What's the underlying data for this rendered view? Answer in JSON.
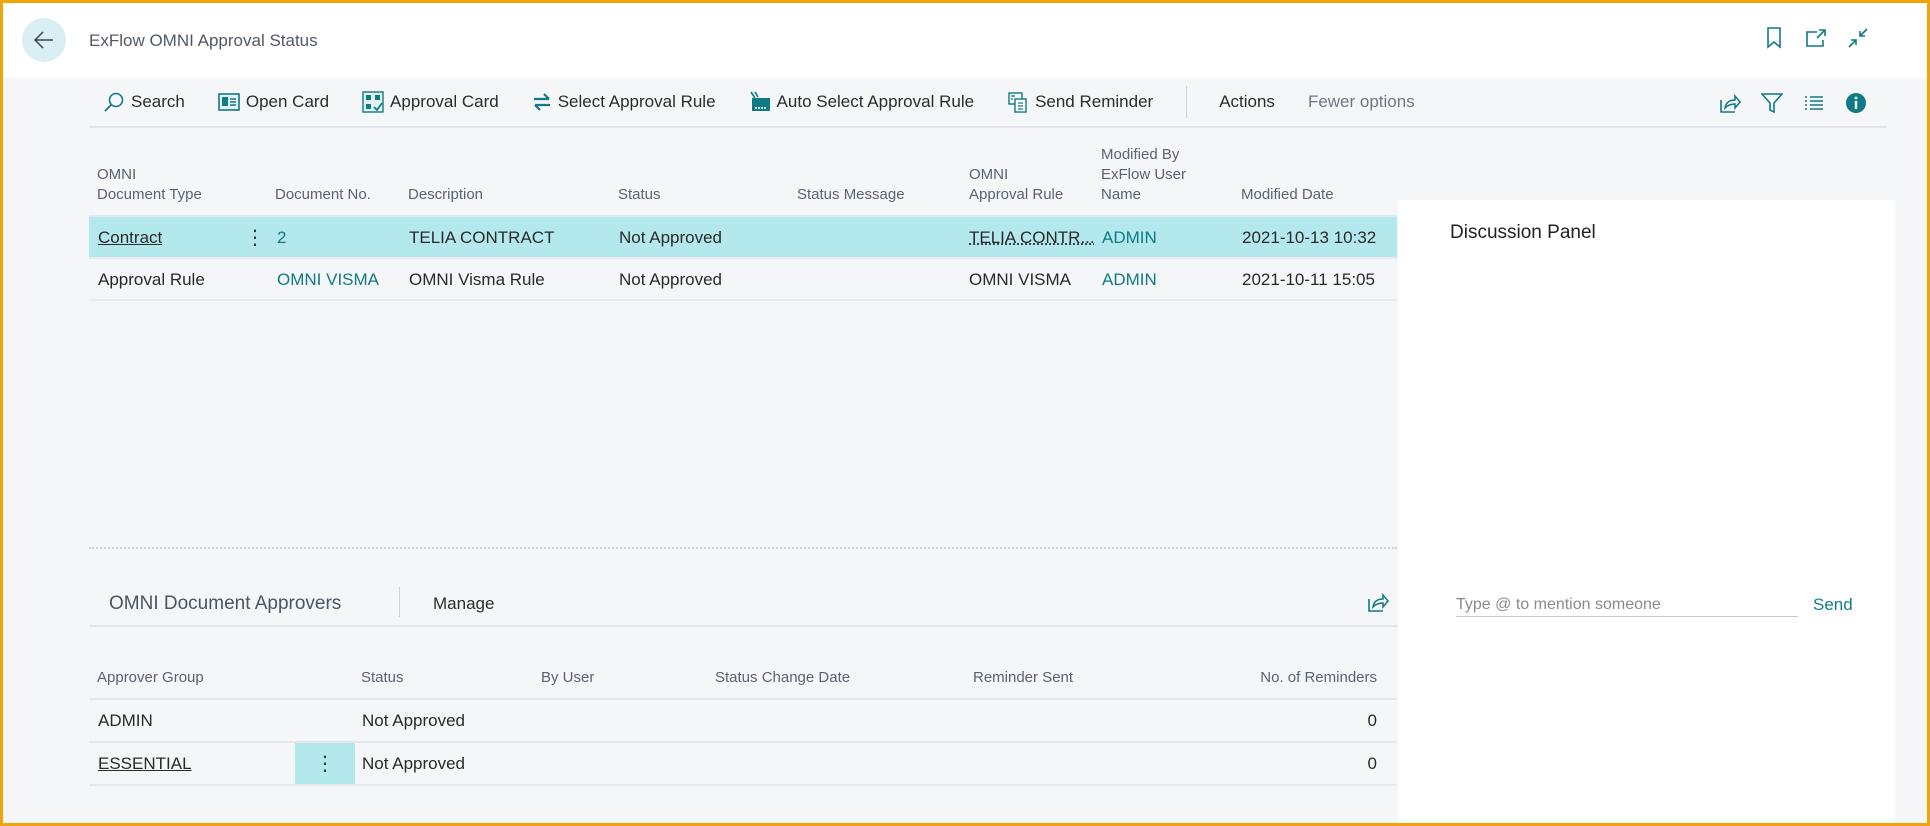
{
  "header": {
    "title": "ExFlow OMNI Approval Status",
    "icons": [
      "back-arrow-icon",
      "bookmark-icon",
      "open-new-window-icon",
      "collapse-icon"
    ]
  },
  "toolbar": {
    "items": [
      {
        "label": "Search",
        "icon": "search-icon"
      },
      {
        "label": "Open Card",
        "icon": "card-icon"
      },
      {
        "label": "Approval Card",
        "icon": "approval-card-icon"
      },
      {
        "label": "Select Approval Rule",
        "icon": "swap-arrows-icon"
      },
      {
        "label": "Auto Select Approval Rule",
        "icon": "auto-select-icon"
      },
      {
        "label": "Send Reminder",
        "icon": "reminder-icon"
      }
    ],
    "actions_label": "Actions",
    "fewer_options_label": "Fewer options",
    "right_icons": [
      "share-icon",
      "filter-icon",
      "list-view-icon",
      "info-icon"
    ]
  },
  "main_table": {
    "columns": [
      {
        "line1": "OMNI",
        "line2": "Document Type",
        "line3": ""
      },
      {
        "line1": "",
        "line2": "Document No.",
        "line3": ""
      },
      {
        "line1": "",
        "line2": "Description",
        "line3": ""
      },
      {
        "line1": "",
        "line2": "Status",
        "line3": ""
      },
      {
        "line1": "",
        "line2": "Status Message",
        "line3": ""
      },
      {
        "line1": "OMNI",
        "line2": "Approval Rule",
        "line3": ""
      },
      {
        "line1": "Modified By",
        "line2": "ExFlow User",
        "line3": "Name"
      },
      {
        "line1": "",
        "line2": "Modified Date",
        "line3": ""
      }
    ],
    "rows": [
      {
        "document_type": "Contract",
        "document_no": "2",
        "description": "TELIA CONTRACT",
        "status": "Not Approved",
        "status_message": "",
        "approval_rule": "TELIA CONTR...",
        "modified_by": "ADMIN",
        "modified_date": "2021-10-13 10:32",
        "selected": true
      },
      {
        "document_type": "Approval Rule",
        "document_no": "OMNI VISMA",
        "description": "OMNI Visma Rule",
        "status": "Not Approved",
        "status_message": "",
        "approval_rule": "OMNI VISMA",
        "modified_by": "ADMIN",
        "modified_date": "2021-10-11 15:05",
        "selected": false
      }
    ]
  },
  "approvers_part": {
    "title": "OMNI Document Approvers",
    "manage_label": "Manage",
    "columns": [
      "Approver Group",
      "Status",
      "By User",
      "Status Change Date",
      "Reminder Sent",
      "No. of Reminders"
    ],
    "rows": [
      {
        "approver_group": "ADMIN",
        "status": "Not Approved",
        "by_user": "",
        "status_change_date": "",
        "reminder_sent": "",
        "no_of_reminders": "0"
      },
      {
        "approver_group": "ESSENTIAL",
        "status": "Not Approved",
        "by_user": "",
        "status_change_date": "",
        "reminder_sent": "",
        "no_of_reminders": "0"
      }
    ]
  },
  "discussion": {
    "title": "Discussion Panel",
    "input_placeholder": "Type @ to mention someone",
    "input_value": "",
    "send_label": "Send"
  },
  "colors": {
    "accent": "#117a83",
    "selected_row": "#b3e8ec",
    "frame_border": "#f0a30a"
  }
}
